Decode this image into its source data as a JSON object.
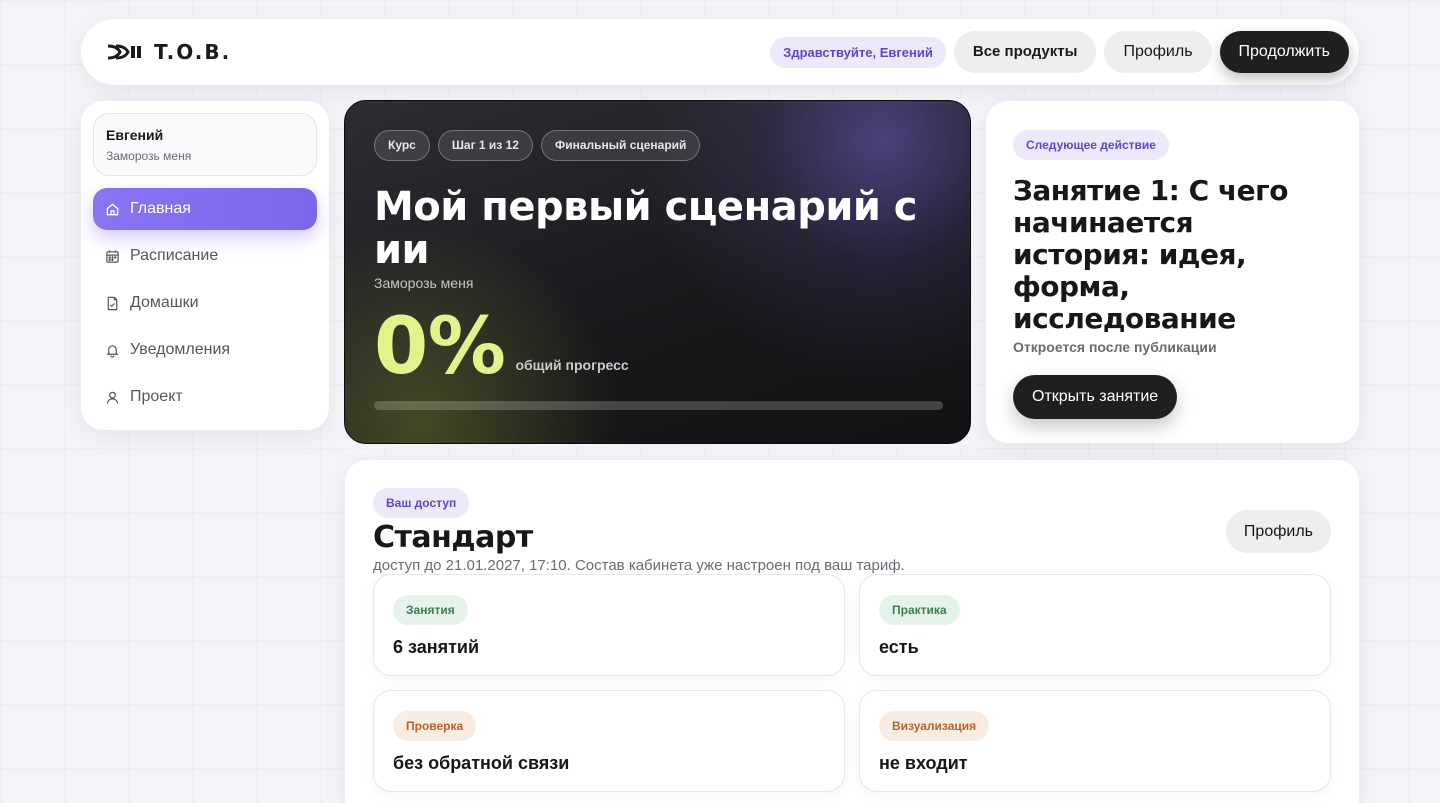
{
  "header": {
    "logo_text": "T.O.B.",
    "greeting": "Здравствуйте, Евгений",
    "all_products": "Все продукты",
    "profile": "Профиль",
    "continue": "Продолжить"
  },
  "sidebar": {
    "user_name": "Евгений",
    "user_subtitle": "Заморозь меня",
    "items": [
      {
        "label": "Главная",
        "icon": "home-icon",
        "active": true
      },
      {
        "label": "Расписание",
        "icon": "calendar-icon",
        "active": false
      },
      {
        "label": "Домашки",
        "icon": "document-icon",
        "active": false
      },
      {
        "label": "Уведомления",
        "icon": "bell-icon",
        "active": false
      },
      {
        "label": "Проект",
        "icon": "user-icon",
        "active": false
      }
    ]
  },
  "hero": {
    "chips": [
      "Курс",
      "Шаг 1 из 12",
      "Финальный сценарий"
    ],
    "title": "Мой первый сценарий с ии",
    "subtitle": "Заморозь меня",
    "progress_value": "0%",
    "progress_fraction": 0,
    "progress_label": "общий прогресс"
  },
  "next_action": {
    "tag": "Следующее действие",
    "title": "Занятие 1: С чего начинается история: идея, форма, исследование",
    "subtitle": "Откроется после публикации",
    "button": "Открыть занятие"
  },
  "access": {
    "tag": "Ваш доступ",
    "title": "Стандарт",
    "subtitle": "доступ до 21.01.2027, 17:10. Состав кабинета уже настроен под ваш тариф.",
    "profile_button": "Профиль",
    "features": [
      {
        "tag": "Занятия",
        "value": "6 занятий",
        "color": "green"
      },
      {
        "tag": "Практика",
        "value": "есть",
        "color": "green"
      },
      {
        "tag": "Проверка",
        "value": "без обратной связи",
        "color": "orange"
      },
      {
        "tag": "Визуализация",
        "value": "не входит",
        "color": "orange"
      }
    ]
  },
  "colors": {
    "accent": "#7d66ea",
    "progress": "#e2f38c",
    "dark": "#1f1f22"
  }
}
